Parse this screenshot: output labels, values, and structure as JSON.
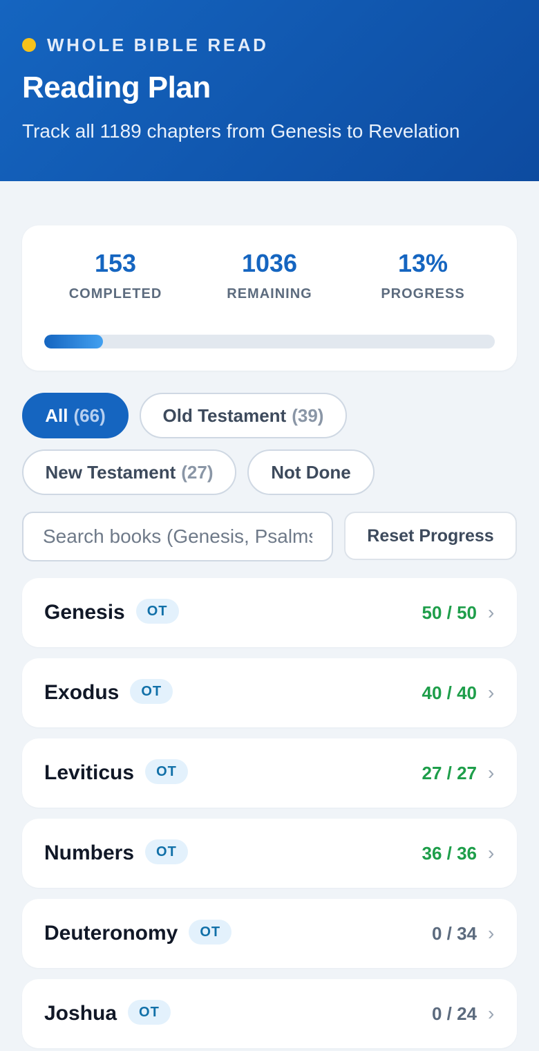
{
  "header": {
    "eyebrow": "WHOLE BIBLE READ",
    "title": "Reading Plan",
    "subtitle": "Track all 1189 chapters from Genesis to Revelation"
  },
  "stats": {
    "completed_value": "153",
    "completed_label": "COMPLETED",
    "remaining_value": "1036",
    "remaining_label": "REMAINING",
    "progress_value": "13%",
    "progress_label": "PROGRESS",
    "progress_fraction": 0.13
  },
  "filters": [
    {
      "label": "All",
      "count": "(66)",
      "active": true
    },
    {
      "label": "Old Testament",
      "count": "(39)",
      "active": false
    },
    {
      "label": "New Testament",
      "count": "(27)",
      "active": false
    },
    {
      "label": "Not Done",
      "count": "",
      "active": false
    }
  ],
  "search": {
    "placeholder": "Search books (Genesis, Psalms...)",
    "value": ""
  },
  "reset_label": "Reset Progress",
  "books": [
    {
      "name": "Genesis",
      "badge": "OT",
      "progress": "50 / 50",
      "done": true
    },
    {
      "name": "Exodus",
      "badge": "OT",
      "progress": "40 / 40",
      "done": true
    },
    {
      "name": "Leviticus",
      "badge": "OT",
      "progress": "27 / 27",
      "done": true
    },
    {
      "name": "Numbers",
      "badge": "OT",
      "progress": "36 / 36",
      "done": true
    },
    {
      "name": "Deuteronomy",
      "badge": "OT",
      "progress": "0 / 34",
      "done": false
    },
    {
      "name": "Joshua",
      "badge": "OT",
      "progress": "0 / 24",
      "done": false
    }
  ],
  "icons": {
    "chevron": "chevron-right-icon",
    "dot": "status-dot-icon"
  },
  "colors": {
    "accent": "#1565c0",
    "done": "#1e9e4a",
    "dot": "#f6c21b"
  }
}
